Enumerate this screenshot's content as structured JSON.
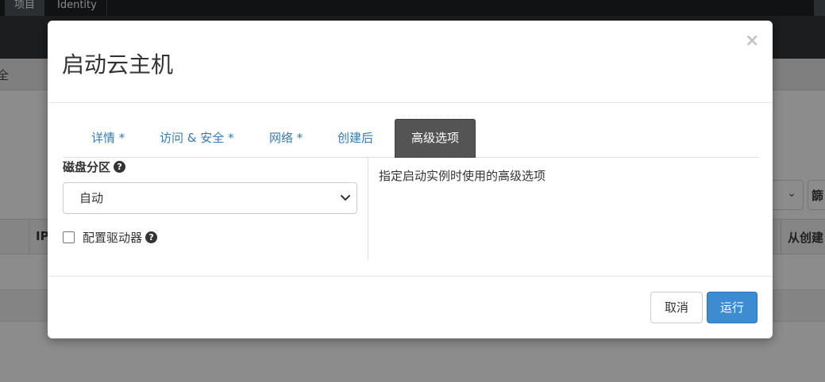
{
  "background": {
    "top_tabs": [
      "项目",
      "Identity"
    ],
    "breadcrumb_fragment": "全",
    "filter_fragment": "篩",
    "table_headers": [
      "IP",
      "从创建"
    ]
  },
  "modal": {
    "title": "启动云主机",
    "close_glyph": "×",
    "tabs": [
      "详情 *",
      "访问 & 安全 *",
      "网络 *",
      "创建后",
      "高级选项"
    ],
    "active_tab": "高级选项",
    "disk_partition": {
      "label": "磁盘分区",
      "help_glyph": "?",
      "selected_value": "自动"
    },
    "config_drive": {
      "label": "配置驱动器",
      "checked": false,
      "help_glyph": "?"
    },
    "description": "指定启动实例时使用的高级选项",
    "footer": {
      "cancel_label": "取消",
      "launch_label": "运行"
    }
  },
  "colors": {
    "primary_button": "#3d8bd0",
    "tab_link": "#337ab7",
    "active_tab_bg": "#545454",
    "overlay_bg": "#8c8c8c"
  }
}
